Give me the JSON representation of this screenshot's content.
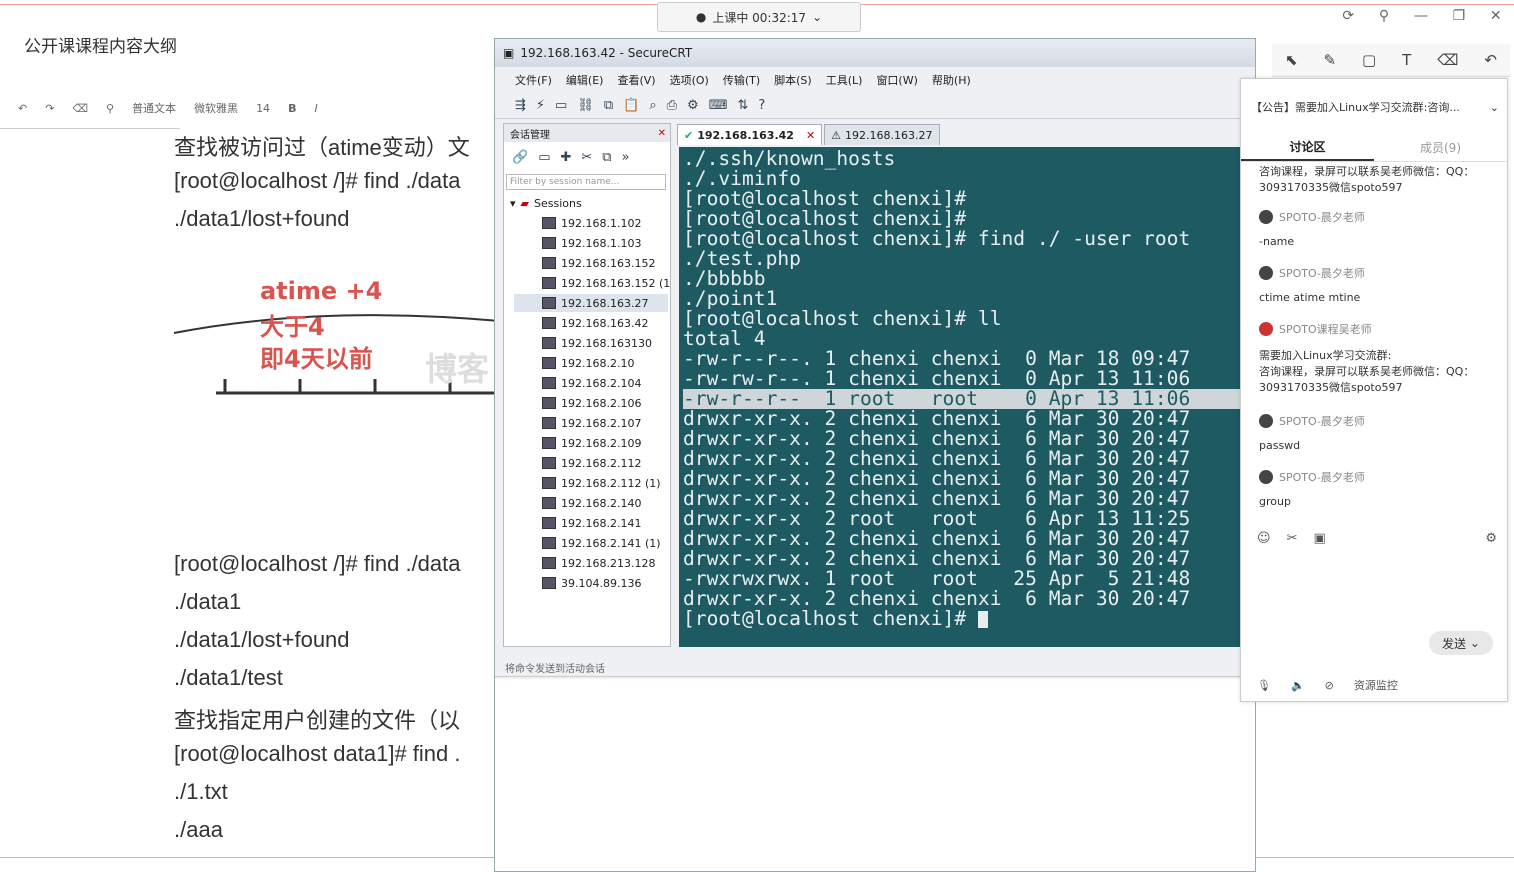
{
  "document": {
    "title": "公开课课程内容大纲",
    "toolbar": {
      "style": "普通文本",
      "font": "微软雅黑",
      "size": "14",
      "bold": "B",
      "italic": "I"
    },
    "lines": [
      "查找被访问过（atime变动）文",
      "[root@localhost /]# find ./data",
      "./data1/lost+found",
      "[root@localhost /]# find ./data",
      "./data1",
      "./data1/lost+found",
      "./data1/test",
      "查找指定用户创建的文件（以",
      "[root@localhost data1]# find .",
      "./1.txt",
      "./aaa"
    ],
    "diagram_notes": [
      "atime +4",
      "大于4",
      "即4天以前"
    ],
    "watermark": "博客"
  },
  "live_banner": {
    "text": "上课中 00:32:17"
  },
  "securecrt": {
    "title": "192.168.163.42 - SecureCRT",
    "menu": [
      "文件(F)",
      "编辑(E)",
      "查看(V)",
      "选项(O)",
      "传输(T)",
      "脚本(S)",
      "工具(L)",
      "窗口(W)",
      "帮助(H)"
    ],
    "session_panel_title": "会话管理",
    "filter_placeholder": "Filter by session name...",
    "sessions_root": "Sessions",
    "sessions": [
      "192.168.1.102",
      "192.168.1.103",
      "192.168.163.152",
      "192.168.163.152 (1",
      "192.168.163.27",
      "192.168.163.42",
      "192.168.163130",
      "192.168.2.10",
      "192.168.2.104",
      "192.168.2.106",
      "192.168.2.107",
      "192.168.2.109",
      "192.168.2.112",
      "192.168.2.112 (1)",
      "192.168.2.140",
      "192.168.2.141",
      "192.168.2.141 (1)",
      "192.168.213.128",
      "39.104.89.136"
    ],
    "tabs": [
      {
        "label": "192.168.163.42",
        "active": true
      },
      {
        "label": "192.168.163.27",
        "active": false
      }
    ],
    "terminal_lines": [
      "./.ssh/known_hosts",
      "./.viminfo",
      "[root@localhost chenxi]#",
      "[root@localhost chenxi]#",
      "[root@localhost chenxi]# find ./ -user root",
      "./test.php",
      "./bbbbb",
      "./point1",
      "[root@localhost chenxi]# ll",
      "total 4",
      "-rw-r--r--. 1 chenxi chenxi  0 Mar 18 09:47",
      "-rw-rw-r--. 1 chenxi chenxi  0 Apr 13 11:06",
      "-rw-r--r--  1 root   root    0 Apr 13 11:06",
      "drwxr-xr-x. 2 chenxi chenxi  6 Mar 30 20:47",
      "drwxr-xr-x. 2 chenxi chenxi  6 Mar 30 20:47",
      "drwxr-xr-x. 2 chenxi chenxi  6 Mar 30 20:47",
      "drwxr-xr-x. 2 chenxi chenxi  6 Mar 30 20:47",
      "drwxr-xr-x. 2 chenxi chenxi  6 Mar 30 20:47",
      "drwxr-xr-x  2 root   root    6 Apr 13 11:25",
      "drwxr-xr-x. 2 chenxi chenxi  6 Mar 30 20:47",
      "drwxr-xr-x. 2 chenxi chenxi  6 Mar 30 20:47",
      "-rwxrwxrwx. 1 root   root   25 Apr  5 21:48",
      "drwxr-xr-x. 2 chenxi chenxi  6 Mar 30 20:47",
      "[root@localhost chenxi]# "
    ],
    "highlighted_line_index": 12,
    "cmd_bar": "将命令发送到活动会话"
  },
  "chat": {
    "notice": "【公告】需要加入Linux学习交流群:咨询...",
    "tabs": [
      "讨论区",
      "成员(9)"
    ],
    "messages": [
      {
        "sender": "",
        "text": "咨询课程，录屏可以联系吴老师微信：QQ："
      },
      {
        "sender": "",
        "text": "3093170335微信spoto597"
      },
      {
        "sender": "SPOTO-晨夕老师",
        "text": "-name"
      },
      {
        "sender": "SPOTO-晨夕老师",
        "text": "ctime atime mtine"
      },
      {
        "sender": "SPOTO课程吴老师",
        "text": "需要加入Linux学习交流群:"
      },
      {
        "sender": "",
        "text": "咨询课程，录屏可以联系吴老师微信：QQ："
      },
      {
        "sender": "",
        "text": "3093170335微信spoto597"
      },
      {
        "sender": "SPOTO-晨夕老师",
        "text": "passwd"
      },
      {
        "sender": "SPOTO-晨夕老师",
        "text": "group"
      }
    ],
    "send_label": "发送",
    "footer_label": "资源监控"
  }
}
